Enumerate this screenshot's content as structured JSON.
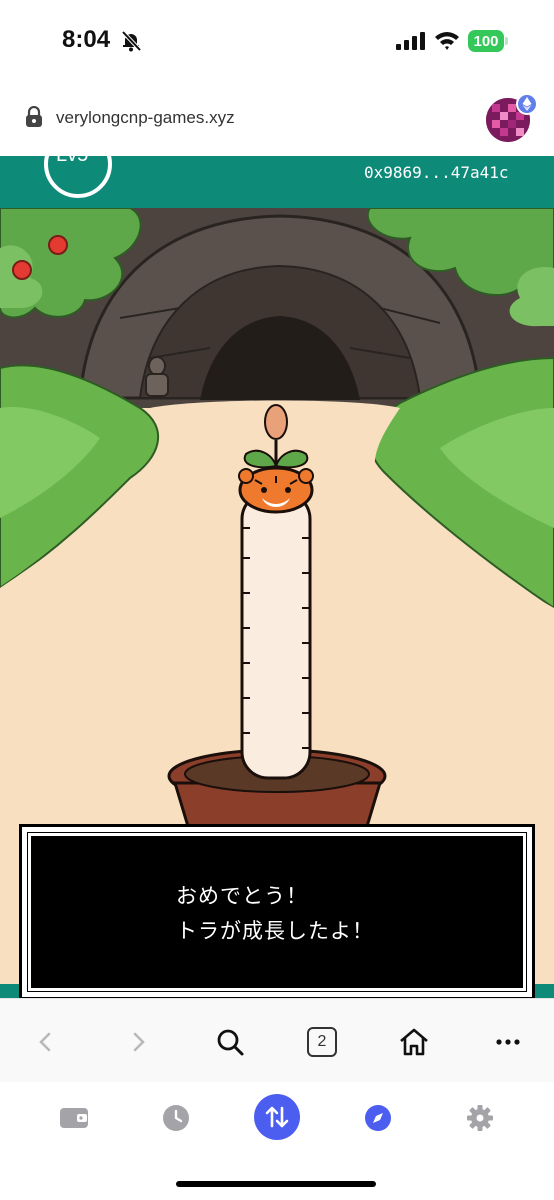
{
  "status_bar": {
    "time": "8:04",
    "battery": "100",
    "icons": [
      "bell-slash-icon",
      "signal-icon",
      "wifi-icon",
      "battery-icon"
    ]
  },
  "browser": {
    "url": "verylongcnp-games.xyz",
    "tab_count": "2",
    "nav_icons": [
      "back-icon",
      "forward-icon",
      "search-icon",
      "tabs-icon",
      "home-icon",
      "more-icon"
    ]
  },
  "game": {
    "level_label": "Lv5",
    "wallet_address": "0x9869...47a41c",
    "dialog": {
      "line1": "おめでとう！",
      "line2": "トラが成長したよ！"
    }
  },
  "tab_bar": {
    "icons": [
      "wallet-icon",
      "history-icon",
      "swap-icon",
      "explore-icon",
      "settings-icon"
    ]
  },
  "colors": {
    "teal": "#0e8a79",
    "swap_blue": "#4b5ef0",
    "battery_green": "#34c759",
    "dialog_bg": "#000000"
  }
}
